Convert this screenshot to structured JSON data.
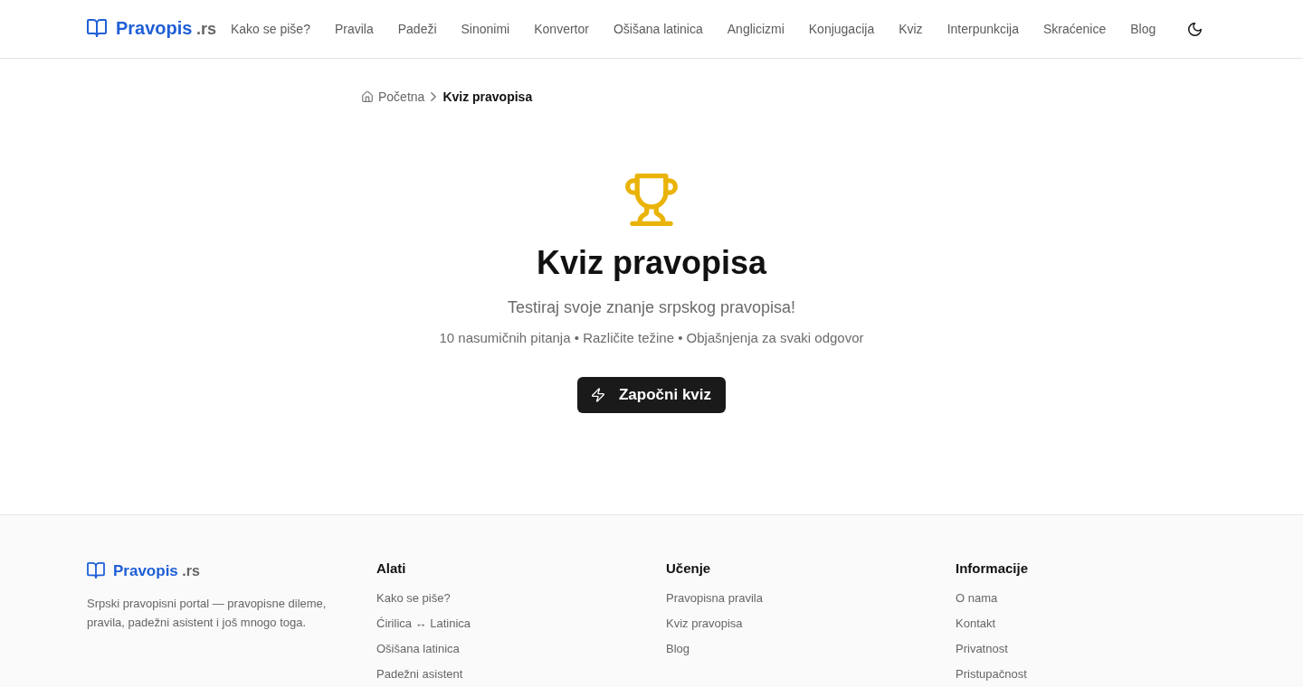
{
  "header": {
    "logo": {
      "name": "Pravopis",
      "suffix": ".rs"
    },
    "nav": [
      "Kako se piše?",
      "Pravila",
      "Padeži",
      "Sinonimi",
      "Konvertor",
      "Ošišana latinica",
      "Anglicizmi",
      "Konjugacija",
      "Kviz",
      "Interpunkcija",
      "Skraćenice",
      "Blog"
    ]
  },
  "breadcrumb": [
    {
      "label": "Početna",
      "kind": "home"
    },
    {
      "label": "Kviz pravopisa",
      "kind": "current"
    }
  ],
  "hero": {
    "title": "Kviz pravopisa",
    "subtitle": "Testiraj svoje znanje srpskog pravopisa!",
    "features": "10 nasumičnih pitanja • Različite težine • Objašnjenja za svaki odgovor",
    "button": "Započni kviz"
  },
  "footer": {
    "logo": {
      "name": "Pravopis",
      "suffix": ".rs"
    },
    "description": "Srpski pravopisni portal — pravopisne dileme, pravila, padežni asistent i još mnogo toga.",
    "columns": [
      {
        "heading": "Alati",
        "links": [
          "Kako se piše?",
          "Ćirilica ↔ Latinica",
          "Ošišana latinica",
          "Padežni asistent"
        ]
      },
      {
        "heading": "Učenje",
        "links": [
          "Pravopisna pravila",
          "Kviz pravopisa",
          "Blog"
        ]
      },
      {
        "heading": "Informacije",
        "links": [
          "O nama",
          "Kontakt",
          "Privatnost",
          "Pristupačnost"
        ]
      }
    ]
  }
}
